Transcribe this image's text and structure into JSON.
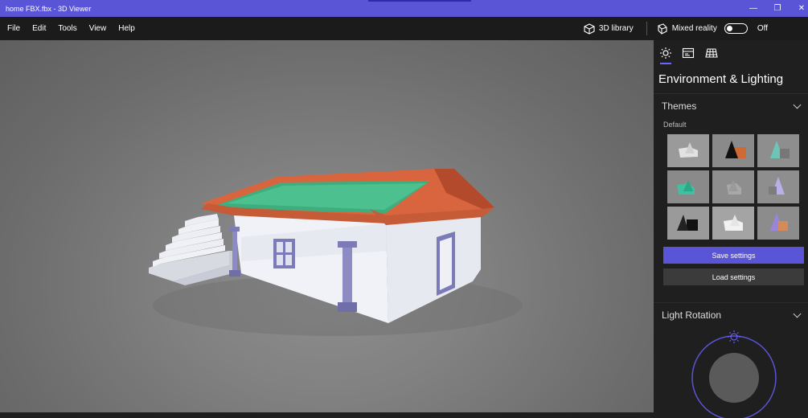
{
  "window": {
    "title": "home FBX.fbx - 3D Viewer"
  },
  "window_controls": {
    "minimize": "—",
    "restore": "❐",
    "close": "✕"
  },
  "menu": {
    "items": [
      {
        "label": "File"
      },
      {
        "label": "Edit"
      },
      {
        "label": "Tools"
      },
      {
        "label": "View"
      },
      {
        "label": "Help"
      }
    ],
    "library_label": "3D library",
    "mixed_reality_label": "Mixed reality",
    "mixed_reality_state": "Off"
  },
  "panel": {
    "tabs": [
      {
        "icon": "sun-icon",
        "active": true
      },
      {
        "icon": "stats-icon",
        "active": false
      },
      {
        "icon": "grid-icon",
        "active": false
      }
    ],
    "title": "Environment & Lighting",
    "themes": {
      "header": "Themes",
      "default_label": "Default",
      "tiles": [
        {
          "name": "default",
          "selected": true
        },
        {
          "name": "orange-black"
        },
        {
          "name": "teal"
        },
        {
          "name": "green"
        },
        {
          "name": "gray"
        },
        {
          "name": "purple"
        },
        {
          "name": "dark"
        },
        {
          "name": "white"
        },
        {
          "name": "sunset"
        }
      ]
    },
    "save_label": "Save settings",
    "load_label": "Load settings",
    "light_rotation": {
      "header": "Light Rotation"
    }
  },
  "colors": {
    "accent": "#5a55d6",
    "titlebar": "#5a55d6",
    "roof": "#d9653f",
    "roof_green": "#3fae7e",
    "wall": "#eceff6",
    "pillar": "#7c7bb8"
  }
}
